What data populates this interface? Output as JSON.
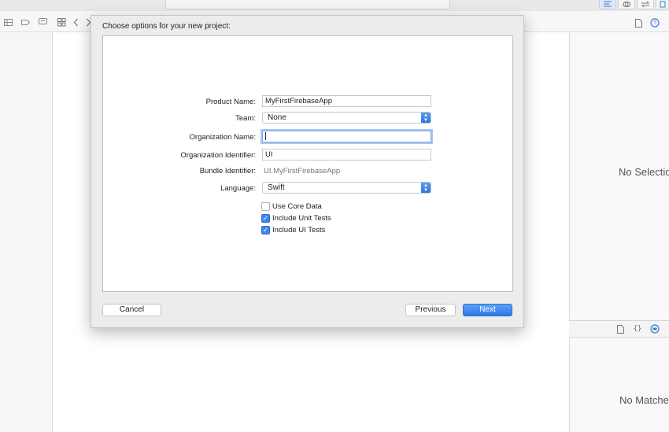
{
  "toolbar": {
    "icons": [
      "editor-standard-icon",
      "editor-assistant-icon",
      "editor-version-icon"
    ]
  },
  "navigator": {
    "icons": [
      "grid-icon",
      "tag-icon",
      "comment-icon",
      "related-items-icon",
      "back-icon",
      "forward-icon"
    ]
  },
  "inspector": {
    "top_icons": [
      "file-icon",
      "help-icon"
    ],
    "no_selection_text": "No Selection",
    "library_icons": [
      "file-template-icon",
      "code-snippet-icon",
      "object-library-icon"
    ],
    "no_matches_text": "No Matches"
  },
  "dialog": {
    "title": "Choose options for your new project:",
    "fields": {
      "product_name_label": "Product Name:",
      "product_name_value": "MyFirstFirebaseApp",
      "team_label": "Team:",
      "team_value": "None",
      "org_name_label": "Organization Name:",
      "org_name_value": "",
      "org_id_label": "Organization Identifier:",
      "org_id_value": "UI",
      "bundle_id_label": "Bundle Identifier:",
      "bundle_id_value": "UI.MyFirstFirebaseApp",
      "language_label": "Language:",
      "language_value": "Swift"
    },
    "checkboxes": [
      {
        "label": "Use Core Data",
        "checked": false
      },
      {
        "label": "Include Unit Tests",
        "checked": true
      },
      {
        "label": "Include UI Tests",
        "checked": true
      }
    ],
    "buttons": {
      "cancel": "Cancel",
      "previous": "Previous",
      "next": "Next"
    }
  },
  "colors": {
    "accent": "#3d86ea",
    "focus_ring": "#a9c7f2"
  }
}
